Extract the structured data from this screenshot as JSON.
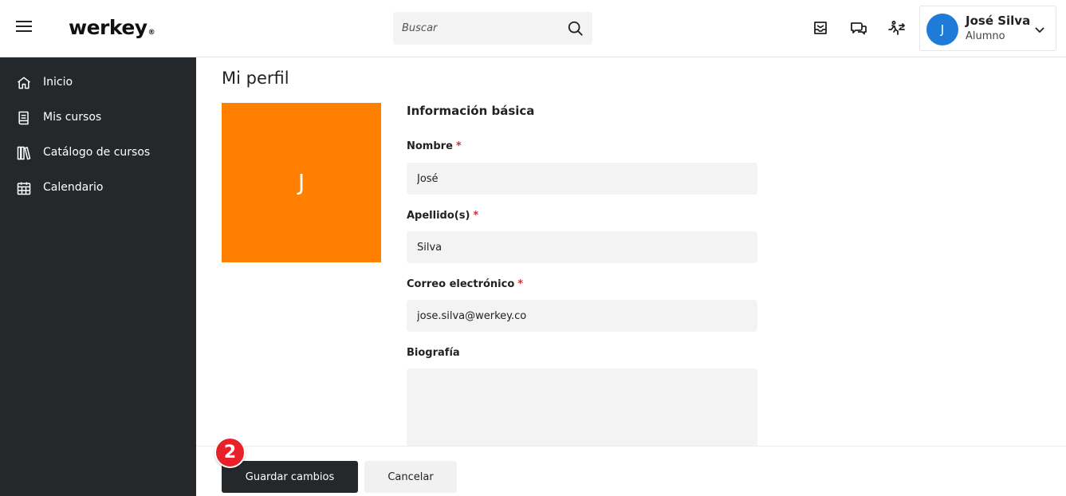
{
  "header": {
    "menu_icon": "hamburger-menu-icon",
    "logo_text": "werkey",
    "logo_mark": "®",
    "search": {
      "placeholder": "Buscar",
      "value": "",
      "icon": "search-icon"
    },
    "icons": [
      "inbox-icon",
      "chat-icon",
      "activity-swap-icon"
    ],
    "user": {
      "avatar_initial": "J",
      "name": "José Silva",
      "role": "Alumno",
      "avatar_color": "#1f7bd8"
    }
  },
  "sidebar": {
    "background": "#25282b",
    "items": [
      {
        "label": "Inicio",
        "icon": "home-icon"
      },
      {
        "label": "Mis cursos",
        "icon": "book-icon"
      },
      {
        "label": "Catálogo de cursos",
        "icon": "library-icon"
      },
      {
        "label": "Calendario",
        "icon": "calendar-icon"
      }
    ]
  },
  "main": {
    "title": "Mi perfil",
    "profile_picture": {
      "initial": "J",
      "color": "#ff8000"
    },
    "form": {
      "section_title": "Información básica",
      "fields": [
        {
          "label": "Nombre",
          "required_mark": "*",
          "value": "José"
        },
        {
          "label": "Apellido(s)",
          "required_mark": "*",
          "value": "Silva"
        },
        {
          "label": "Correo electrónico",
          "required_mark": "*",
          "value": "jose.silva@werkey.co"
        }
      ],
      "bio": {
        "label": "Biografía",
        "value": ""
      }
    }
  },
  "footer": {
    "save_label": "Guardar cambios",
    "cancel_label": "Cancelar",
    "step_badge": "2",
    "step_badge_color": "#e8202a"
  }
}
